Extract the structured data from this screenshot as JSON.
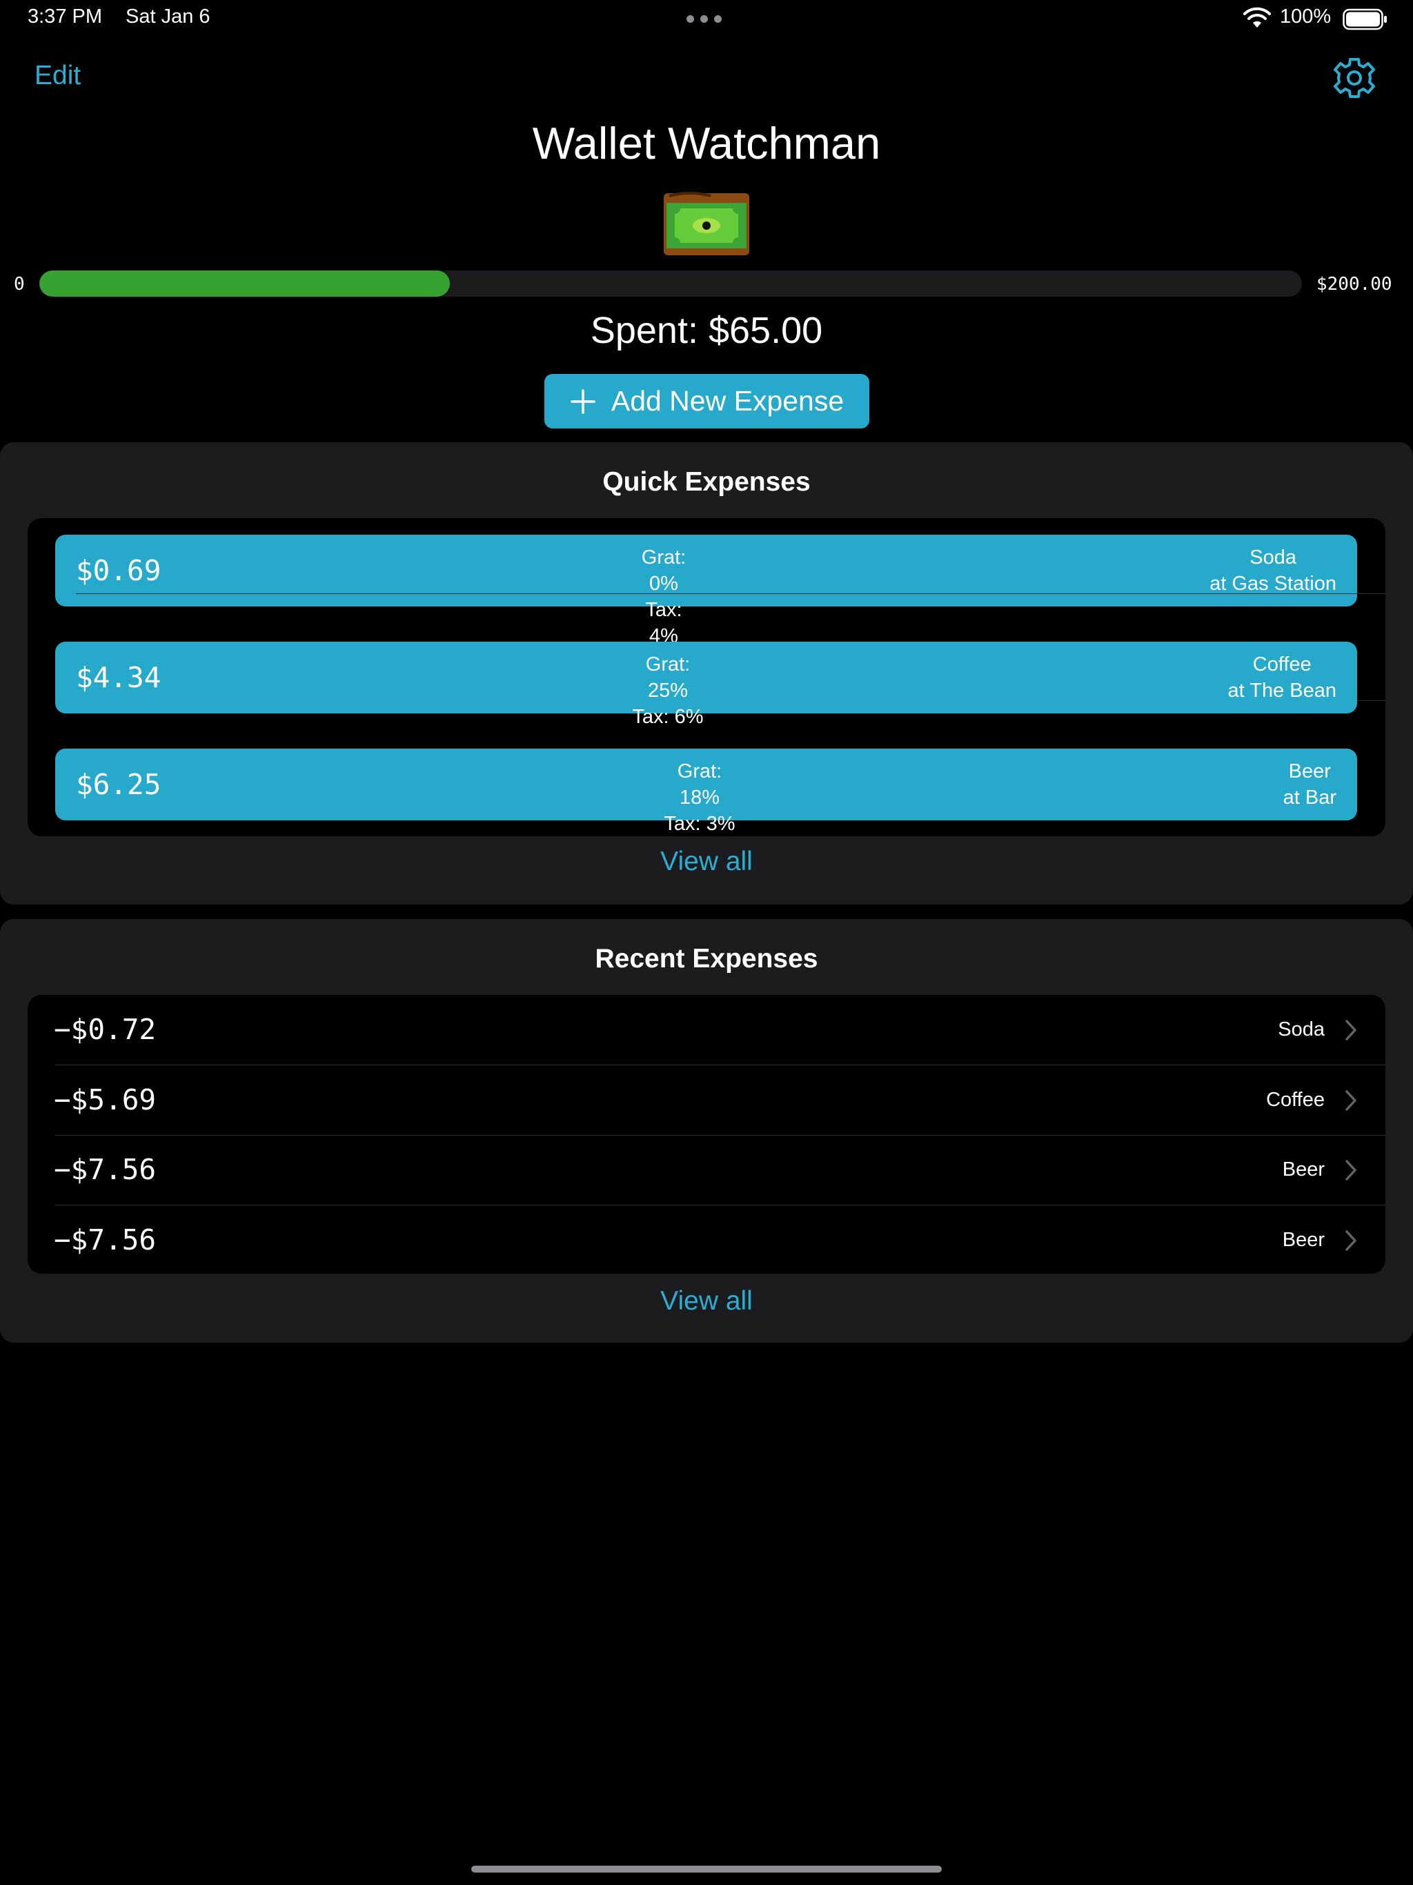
{
  "status_bar": {
    "time": "3:37 PM",
    "date": "Sat Jan 6",
    "battery_percent": "100%",
    "icons": [
      "wifi-icon",
      "battery-icon",
      "multitask-dots"
    ]
  },
  "nav": {
    "edit_label": "Edit",
    "settings_icon": "gear-icon"
  },
  "header": {
    "title": "Wallet Watchman",
    "logo_icon": "wallet-eye-logo"
  },
  "budget": {
    "min_label": "0",
    "max_label": "$200.00",
    "progress_fraction": 0.325,
    "spent_text": "Spent: $65.00"
  },
  "add_button": {
    "label": "Add New Expense",
    "icon": "plus-icon"
  },
  "quick_expenses": {
    "title": "Quick Expenses",
    "items": [
      {
        "amount": "$0.69",
        "grat": "Grat: 0%",
        "tax": "Tax: 4%",
        "name": "Soda",
        "location": "at Gas Station"
      },
      {
        "amount": "$4.34",
        "grat": "Grat: 25%",
        "tax": "Tax: 6%",
        "name": "Coffee",
        "location": "at The Bean"
      },
      {
        "amount": "$6.25",
        "grat": "Grat: 18%",
        "tax": "Tax: 3%",
        "name": "Beer",
        "location": "at Bar"
      }
    ],
    "view_all_label": "View all"
  },
  "recent_expenses": {
    "title": "Recent Expenses",
    "items": [
      {
        "amount": "−$0.72",
        "name": "Soda"
      },
      {
        "amount": "−$5.69",
        "name": "Coffee"
      },
      {
        "amount": "−$7.56",
        "name": "Beer"
      },
      {
        "amount": "−$7.56",
        "name": "Beer"
      }
    ],
    "view_all_label": "View all"
  },
  "colors": {
    "background": "#000000",
    "section_bg": "#1c1c1e",
    "accent": "#26a9ca",
    "link": "#2aaed3",
    "progress": "#37a232"
  }
}
